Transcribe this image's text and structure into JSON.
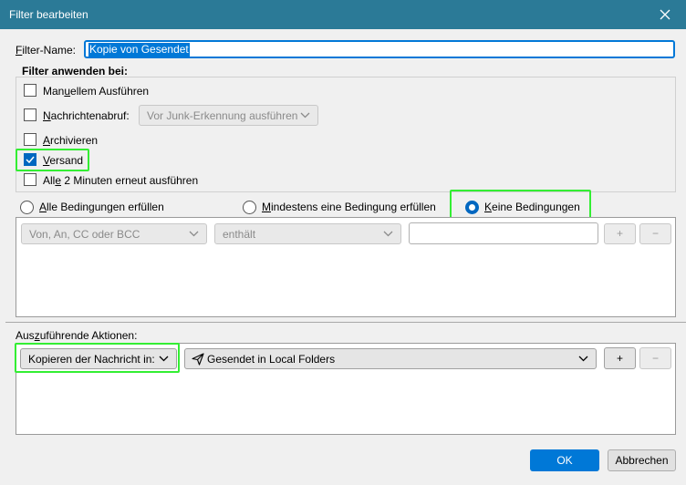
{
  "window": {
    "title": "Filter bearbeiten"
  },
  "filter_name": {
    "label": "Filter-Name:",
    "value": "Kopie von Gesendet"
  },
  "apply": {
    "heading": "Filter anwenden bei:",
    "manual": {
      "label": "Manuellem Ausführen",
      "checked": false
    },
    "fetch": {
      "label": "Nachrichtenabruf:",
      "checked": false,
      "dropdown": "Vor Junk-Erkennung ausführen"
    },
    "archive": {
      "label": "Archivieren",
      "checked": false
    },
    "send": {
      "label": "Versand",
      "checked": true
    },
    "periodic": {
      "label": "Alle 2 Minuten erneut ausführen",
      "checked": false
    }
  },
  "conditions": {
    "all": "Alle Bedingungen erfüllen",
    "any": "Mindestens eine Bedingung erfüllen",
    "none": "Keine Bedingungen",
    "selected": "none",
    "row": {
      "field": "Von, An, CC oder BCC",
      "operator": "enthält",
      "value": "",
      "add": "+",
      "remove": "−"
    }
  },
  "actions": {
    "label": "Auszuführende Aktionen:",
    "row": {
      "action": "Kopieren der Nachricht in:",
      "target": "Gesendet in Local Folders",
      "add": "+",
      "remove": "−"
    }
  },
  "footer": {
    "ok": "OK",
    "cancel": "Abbrechen"
  },
  "colors": {
    "titlebar": "#2b7a97",
    "accent": "#0078d7",
    "highlight": "#33ee33"
  }
}
